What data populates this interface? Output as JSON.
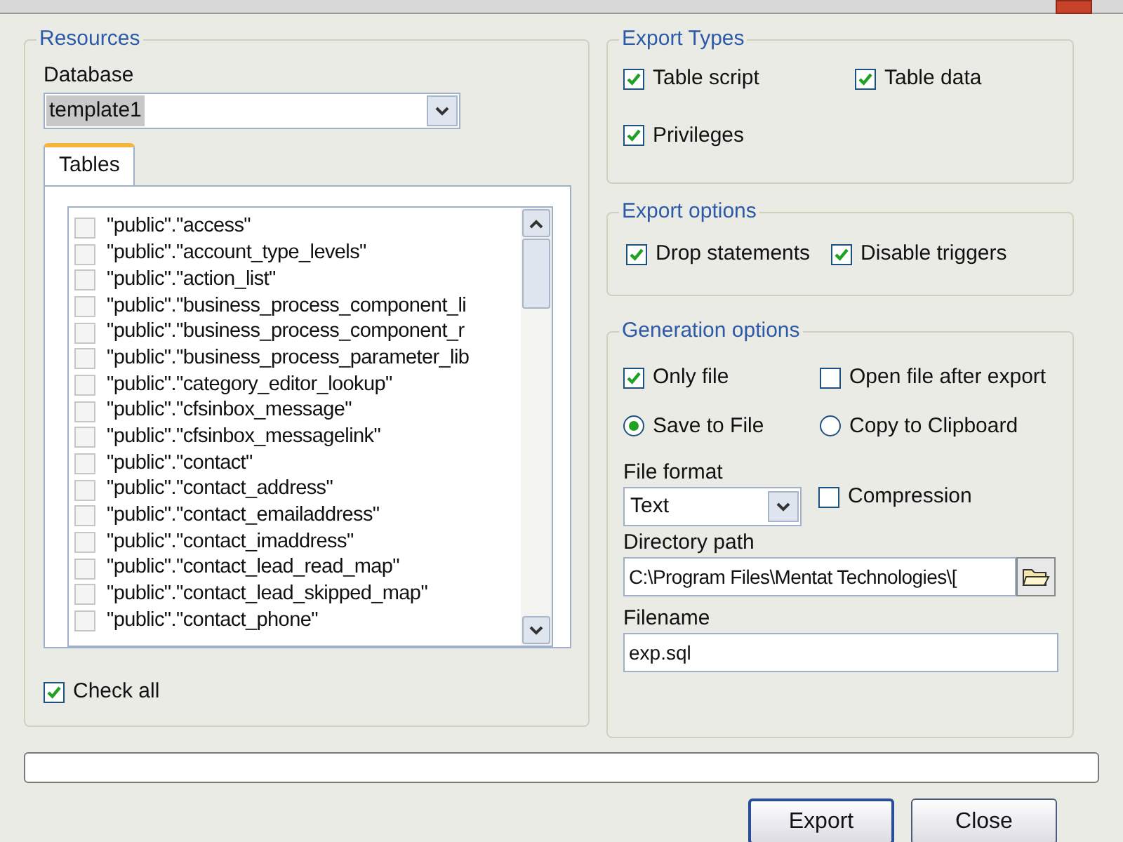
{
  "resources": {
    "title": "Resources",
    "database_label": "Database",
    "database": {
      "value": "template1"
    },
    "tabs": [
      {
        "label": "Tables",
        "selected": true
      }
    ],
    "tables": [
      {
        "label": "\"public\".\"access\"",
        "checked": false
      },
      {
        "label": "\"public\".\"account_type_levels\"",
        "checked": false
      },
      {
        "label": "\"public\".\"action_list\"",
        "checked": false
      },
      {
        "label": "\"public\".\"business_process_component_li",
        "checked": false
      },
      {
        "label": "\"public\".\"business_process_component_r",
        "checked": false
      },
      {
        "label": "\"public\".\"business_process_parameter_lib",
        "checked": false
      },
      {
        "label": "\"public\".\"category_editor_lookup\"",
        "checked": false
      },
      {
        "label": "\"public\".\"cfsinbox_message\"",
        "checked": false
      },
      {
        "label": "\"public\".\"cfsinbox_messagelink\"",
        "checked": false
      },
      {
        "label": "\"public\".\"contact\"",
        "checked": false
      },
      {
        "label": "\"public\".\"contact_address\"",
        "checked": false
      },
      {
        "label": "\"public\".\"contact_emailaddress\"",
        "checked": false
      },
      {
        "label": "\"public\".\"contact_imaddress\"",
        "checked": false
      },
      {
        "label": "\"public\".\"contact_lead_read_map\"",
        "checked": false
      },
      {
        "label": "\"public\".\"contact_lead_skipped_map\"",
        "checked": false
      },
      {
        "label": "\"public\".\"contact_phone\"",
        "checked": false
      }
    ],
    "check_all": {
      "label": "Check all",
      "checked": true
    }
  },
  "export_types": {
    "title": "Export Types",
    "options": [
      {
        "label": "Table script",
        "checked": true
      },
      {
        "label": "Table data",
        "checked": true
      },
      {
        "label": "Privileges",
        "checked": true
      }
    ]
  },
  "export_options": {
    "title": "Export options",
    "options": [
      {
        "label": "Drop statements",
        "checked": true
      },
      {
        "label": "Disable triggers",
        "checked": true
      }
    ]
  },
  "generation_options": {
    "title": "Generation options",
    "only_file": {
      "label": "Only file",
      "checked": true
    },
    "open_after": {
      "label": "Open file after export",
      "checked": false
    },
    "destinations": [
      {
        "label": "Save to File",
        "selected": true
      },
      {
        "label": "Copy to Clipboard",
        "selected": false
      }
    ],
    "file_format_label": "File format",
    "file_format": {
      "value": "Text"
    },
    "compression": {
      "label": "Compression",
      "checked": false
    },
    "directory_label": "Directory path",
    "directory": {
      "value": "C:\\Program Files\\Mentat Technologies\\["
    },
    "filename_label": "Filename",
    "filename": {
      "value": "exp.sql"
    }
  },
  "progress": {
    "level": 0
  },
  "buttons": [
    "Export",
    "Close"
  ]
}
